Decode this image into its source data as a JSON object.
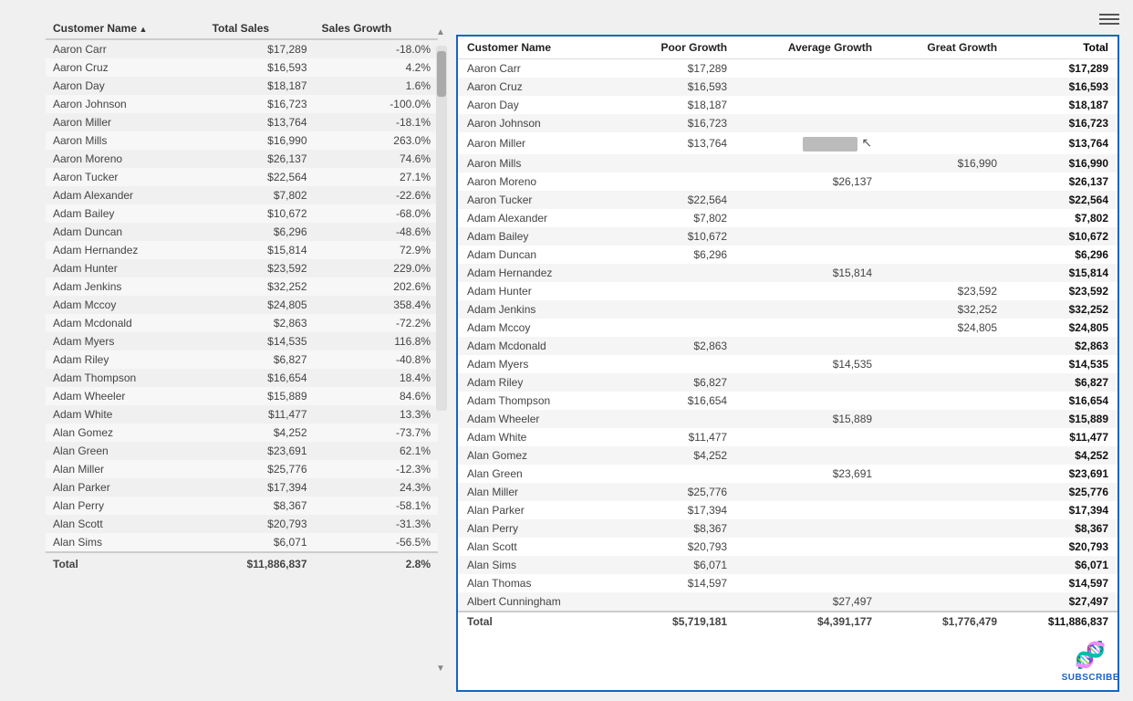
{
  "left_table": {
    "headers": [
      "Customer Name",
      "Total Sales",
      "Sales Growth"
    ],
    "rows": [
      [
        "Aaron Carr",
        "$17,289",
        "-18.0%"
      ],
      [
        "Aaron Cruz",
        "$16,593",
        "4.2%"
      ],
      [
        "Aaron Day",
        "$18,187",
        "1.6%"
      ],
      [
        "Aaron Johnson",
        "$16,723",
        "-100.0%"
      ],
      [
        "Aaron Miller",
        "$13,764",
        "-18.1%"
      ],
      [
        "Aaron Mills",
        "$16,990",
        "263.0%"
      ],
      [
        "Aaron Moreno",
        "$26,137",
        "74.6%"
      ],
      [
        "Aaron Tucker",
        "$22,564",
        "27.1%"
      ],
      [
        "Adam Alexander",
        "$7,802",
        "-22.6%"
      ],
      [
        "Adam Bailey",
        "$10,672",
        "-68.0%"
      ],
      [
        "Adam Duncan",
        "$6,296",
        "-48.6%"
      ],
      [
        "Adam Hernandez",
        "$15,814",
        "72.9%"
      ],
      [
        "Adam Hunter",
        "$23,592",
        "229.0%"
      ],
      [
        "Adam Jenkins",
        "$32,252",
        "202.6%"
      ],
      [
        "Adam Mccoy",
        "$24,805",
        "358.4%"
      ],
      [
        "Adam Mcdonald",
        "$2,863",
        "-72.2%"
      ],
      [
        "Adam Myers",
        "$14,535",
        "116.8%"
      ],
      [
        "Adam Riley",
        "$6,827",
        "-40.8%"
      ],
      [
        "Adam Thompson",
        "$16,654",
        "18.4%"
      ],
      [
        "Adam Wheeler",
        "$15,889",
        "84.6%"
      ],
      [
        "Adam White",
        "$11,477",
        "13.3%"
      ],
      [
        "Alan Gomez",
        "$4,252",
        "-73.7%"
      ],
      [
        "Alan Green",
        "$23,691",
        "62.1%"
      ],
      [
        "Alan Miller",
        "$25,776",
        "-12.3%"
      ],
      [
        "Alan Parker",
        "$17,394",
        "24.3%"
      ],
      [
        "Alan Perry",
        "$8,367",
        "-58.1%"
      ],
      [
        "Alan Scott",
        "$20,793",
        "-31.3%"
      ],
      [
        "Alan Sims",
        "$6,071",
        "-56.5%"
      ]
    ],
    "total_row": [
      "Total",
      "$11,886,837",
      "2.8%"
    ]
  },
  "right_table": {
    "headers": [
      "Customer Name",
      "Poor Growth",
      "Average Growth",
      "Great Growth",
      "Total"
    ],
    "rows": [
      [
        "Aaron Carr",
        "$17,289",
        "",
        "",
        "$17,289"
      ],
      [
        "Aaron Cruz",
        "$16,593",
        "",
        "",
        "$16,593"
      ],
      [
        "Aaron Day",
        "$18,187",
        "",
        "",
        "$18,187"
      ],
      [
        "Aaron Johnson",
        "$16,723",
        "",
        "",
        "$16,723"
      ],
      [
        "Aaron Miller",
        "$13,764",
        "GRAYBAR",
        "",
        "$13,764"
      ],
      [
        "Aaron Mills",
        "",
        "",
        "$16,990",
        "$16,990"
      ],
      [
        "Aaron Moreno",
        "",
        "$26,137",
        "",
        "$26,137"
      ],
      [
        "Aaron Tucker",
        "$22,564",
        "",
        "",
        "$22,564"
      ],
      [
        "Adam Alexander",
        "$7,802",
        "",
        "",
        "$7,802"
      ],
      [
        "Adam Bailey",
        "$10,672",
        "",
        "",
        "$10,672"
      ],
      [
        "Adam Duncan",
        "$6,296",
        "",
        "",
        "$6,296"
      ],
      [
        "Adam Hernandez",
        "",
        "$15,814",
        "",
        "$15,814"
      ],
      [
        "Adam Hunter",
        "",
        "",
        "$23,592",
        "$23,592"
      ],
      [
        "Adam Jenkins",
        "",
        "",
        "$32,252",
        "$32,252"
      ],
      [
        "Adam Mccoy",
        "",
        "",
        "$24,805",
        "$24,805"
      ],
      [
        "Adam Mcdonald",
        "$2,863",
        "",
        "",
        "$2,863"
      ],
      [
        "Adam Myers",
        "",
        "$14,535",
        "",
        "$14,535"
      ],
      [
        "Adam Riley",
        "$6,827",
        "",
        "",
        "$6,827"
      ],
      [
        "Adam Thompson",
        "$16,654",
        "",
        "",
        "$16,654"
      ],
      [
        "Adam Wheeler",
        "",
        "$15,889",
        "",
        "$15,889"
      ],
      [
        "Adam White",
        "$11,477",
        "",
        "",
        "$11,477"
      ],
      [
        "Alan Gomez",
        "$4,252",
        "",
        "",
        "$4,252"
      ],
      [
        "Alan Green",
        "",
        "$23,691",
        "",
        "$23,691"
      ],
      [
        "Alan Miller",
        "$25,776",
        "",
        "",
        "$25,776"
      ],
      [
        "Alan Parker",
        "$17,394",
        "",
        "",
        "$17,394"
      ],
      [
        "Alan Perry",
        "$8,367",
        "",
        "",
        "$8,367"
      ],
      [
        "Alan Scott",
        "$20,793",
        "",
        "",
        "$20,793"
      ],
      [
        "Alan Sims",
        "$6,071",
        "",
        "",
        "$6,071"
      ],
      [
        "Alan Thomas",
        "$14,597",
        "",
        "",
        "$14,597"
      ],
      [
        "Albert Cunningham",
        "",
        "$27,497",
        "",
        "$27,497"
      ]
    ],
    "total_row": [
      "Total",
      "$5,719,181",
      "$4,391,177",
      "$1,776,479",
      "$11,886,837"
    ]
  },
  "subscribe": {
    "label": "SUBSCRIBE"
  },
  "ui": {
    "hamburger_visible": true
  }
}
